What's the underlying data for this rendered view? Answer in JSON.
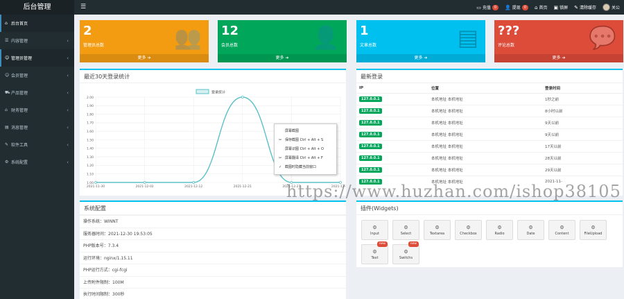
{
  "header": {
    "logo": "后台管理",
    "toggle_icon": "☰",
    "nav": [
      {
        "icon": "credit-card-icon",
        "glyph": "▭",
        "label": "充值",
        "badge": "0"
      },
      {
        "icon": "user-icon",
        "glyph": "👤",
        "label": "提现",
        "badge": "0"
      },
      {
        "icon": "home-icon",
        "glyph": "⌂",
        "label": "首页"
      },
      {
        "icon": "monitor-icon",
        "glyph": "▣",
        "label": "锁屏"
      },
      {
        "icon": "brush-icon",
        "glyph": "✎",
        "label": "清除缓存"
      },
      {
        "icon": "avatar",
        "label": "关公"
      }
    ]
  },
  "sidebar": {
    "items": [
      {
        "icon": "home-icon",
        "glyph": "⌂",
        "label": "后台首页"
      },
      {
        "icon": "list-icon",
        "glyph": "☰",
        "label": "内容管理",
        "arrow": "‹"
      },
      {
        "icon": "users-icon",
        "glyph": "☺",
        "label": "管理员管理",
        "arrow": "‹"
      },
      {
        "icon": "group-icon",
        "glyph": "☺",
        "label": "会员管理",
        "arrow": "‹"
      },
      {
        "icon": "cart-icon",
        "glyph": "⛟",
        "label": "产品管理",
        "arrow": "‹"
      },
      {
        "icon": "bank-icon",
        "glyph": "⌂",
        "label": "财务管理",
        "arrow": "‹"
      },
      {
        "icon": "chart-icon",
        "glyph": "▤",
        "label": "消息管理",
        "arrow": "‹"
      },
      {
        "icon": "wrench-icon",
        "glyph": "✎",
        "label": "软件工具",
        "arrow": "‹"
      },
      {
        "icon": "gear-icon",
        "glyph": "⚙",
        "label": "系统配置",
        "arrow": "‹"
      }
    ]
  },
  "stats": [
    {
      "value": "2",
      "label": "管理员总数",
      "more": "更多 ➔",
      "color": "#f39c12",
      "icon": "users-icon",
      "glyph": "👥"
    },
    {
      "value": "12",
      "label": "会员总数",
      "more": "更多 ➔",
      "color": "#00a65a",
      "icon": "user-plus-icon",
      "glyph": "👤"
    },
    {
      "value": "1",
      "label": "文章总数",
      "more": "更多 ➔",
      "color": "#00c0ef",
      "icon": "document-icon",
      "glyph": "▤"
    },
    {
      "value": "???",
      "label": "评论总数",
      "more": "更多 ➔",
      "color": "#dd4b39",
      "icon": "comment-icon",
      "glyph": "💬"
    }
  ],
  "login_chart": {
    "panel_title": "最近30天登录统计",
    "legend": "登录统计",
    "line_color": "#5bc0c8"
  },
  "chart_data": {
    "type": "line",
    "title": "最近30天登录统计",
    "series": [
      {
        "name": "登录统计",
        "x": [
          "2021-11-30",
          "2021-12-02",
          "2021-12-12",
          "2021-12-21",
          "2021-12-27",
          "2021-12-30"
        ],
        "values": [
          1.0,
          1.0,
          1.0,
          2.0,
          1.0,
          1.0
        ]
      }
    ],
    "x_ticks": [
      "2021-11-30",
      "2021-12-02",
      "2021-12-12",
      "2021-12-21",
      "2021-12-27",
      "2021-12-30"
    ],
    "y_ticks": [
      "2.00",
      "1.90",
      "1.80",
      "1.70",
      "1.60",
      "1.50",
      "1.40",
      "1.30",
      "1.20",
      "1.10",
      "1.00"
    ],
    "ylim": [
      1.0,
      2.0
    ],
    "grid": true,
    "legend_position": "top"
  },
  "context_menu": {
    "items": [
      {
        "label": "屏幕截图",
        "icon": ""
      },
      {
        "label": "保存截图 Ctrl + Alt + S",
        "icon": "✂"
      },
      {
        "label": "屏幕识图 Ctrl + Alt + O",
        "icon": ""
      },
      {
        "label": "屏幕翻译 Ctrl + Alt + F",
        "icon": "✂"
      },
      {
        "label": "截图时隐藏当前窗口",
        "icon": "✓"
      }
    ]
  },
  "recent_logins": {
    "title": "最新登录",
    "columns": [
      "IP",
      "位置",
      "登录时间"
    ],
    "rows": [
      {
        "ip": "127.0.0.1",
        "location": "本机地址 本机地址",
        "time": "1秒之前"
      },
      {
        "ip": "127.0.0.1",
        "location": "本机地址 本机地址",
        "time": "8小时以前"
      },
      {
        "ip": "127.0.0.1",
        "location": "本机地址 本机地址",
        "time": "9天以前"
      },
      {
        "ip": "127.0.0.1",
        "location": "本机地址 本机地址",
        "time": "9天以前"
      },
      {
        "ip": "127.0.0.1",
        "location": "本机地址 本机地址",
        "time": "17天以前"
      },
      {
        "ip": "127.0.0.1",
        "location": "本机地址 本机地址",
        "time": "28天以前"
      },
      {
        "ip": "127.0.0.1",
        "location": "本机地址 本机地址",
        "time": "29天以前"
      },
      {
        "ip": "127.0.0.1",
        "location": "本机地址 本机地址",
        "time": "2021-11-"
      }
    ]
  },
  "system": {
    "title": "系统配置",
    "rows": [
      "操作系统：WINNT",
      "服务器时间：2021-12-30 19:53:05",
      "PHP版本号：7.3.4",
      "运行环境：nginx/1.15.11",
      "PHP运行方式：cgi-fcgi",
      "上传附件限制：100M",
      "执行时间限制：300秒"
    ]
  },
  "widgets": {
    "title": "插件(Widgets)",
    "items": [
      {
        "label": "Input"
      },
      {
        "label": "Select"
      },
      {
        "label": "Textarea"
      },
      {
        "label": "Checkbox"
      },
      {
        "label": "Radio"
      },
      {
        "label": "Date"
      },
      {
        "label": "Content"
      },
      {
        "label": "FileUpload"
      },
      {
        "label": "Text",
        "badge": "new"
      },
      {
        "label": "Switchs",
        "badge": "new"
      }
    ],
    "icon_glyph": "⚙"
  },
  "watermark": "https://www.huzhan.com/ishop38105"
}
